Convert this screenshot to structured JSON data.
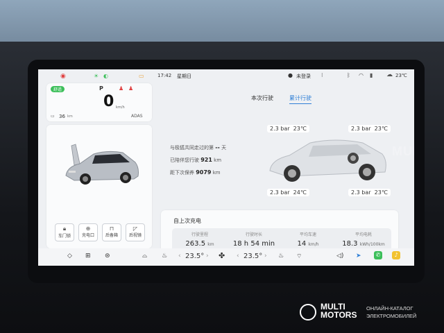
{
  "status": {
    "drive_mode": "舒适",
    "gear": "P",
    "speed": "0",
    "speed_unit": "km/h",
    "range": "36",
    "range_unit": "km",
    "adas": "ADAS",
    "time": "17:42",
    "weekday": "星期日",
    "login": "未登录",
    "temperature": "23℃"
  },
  "tabs": [
    "本次行驶",
    "累计行驶"
  ],
  "active_tab": 1,
  "companion": {
    "line1_prefix": "与极狐共同走过的第",
    "line1_value": "--",
    "line1_suffix": "天",
    "line2_prefix": "已陪伴您行驶",
    "line2_value": "921",
    "line2_unit": "km",
    "line3_prefix": "距下次保养",
    "line3_value": "9079",
    "line3_unit": "km"
  },
  "tires": {
    "front_left": {
      "pressure": "2.3 bar",
      "temp": "23℃"
    },
    "rear_left": {
      "pressure": "2.3 bar",
      "temp": "23℃"
    },
    "front_right": {
      "pressure": "2.3 bar",
      "temp": "24℃"
    },
    "rear_right": {
      "pressure": "2.3 bar",
      "temp": "23℃"
    }
  },
  "car_buttons": [
    {
      "label": "车门锁",
      "icon": "lock-icon"
    },
    {
      "label": "充电口",
      "icon": "charge-port-icon"
    },
    {
      "label": "后备箱",
      "icon": "trunk-icon"
    },
    {
      "label": "后视镜",
      "icon": "mirror-icon"
    }
  ],
  "charge_section": {
    "title": "自上次充电",
    "stats": [
      {
        "label": "行驶里程",
        "value": "263.5",
        "unit": "km"
      },
      {
        "label": "行驶时长",
        "value": "18 h 54 min",
        "unit": ""
      },
      {
        "label": "平均车速",
        "value": "14",
        "unit": "km/h"
      },
      {
        "label": "平均电耗",
        "value": "18.3",
        "unit": "kWh/100km"
      }
    ]
  },
  "bottom_bar": {
    "temp_left": "23.5°",
    "temp_right": "23.5°"
  },
  "watermark": {
    "brand_line1": "MULTI",
    "brand_line2": "MOTORS",
    "caption_line1": "ОНЛАЙН-КАТАЛОГ",
    "caption_line2": "ЭЛЕКТРОМОБИЛЕЙ"
  },
  "colors": {
    "accent": "#2f7fd6",
    "green": "#3cbf5a",
    "red": "#e04040",
    "screen_bg": "#eef0f3"
  }
}
